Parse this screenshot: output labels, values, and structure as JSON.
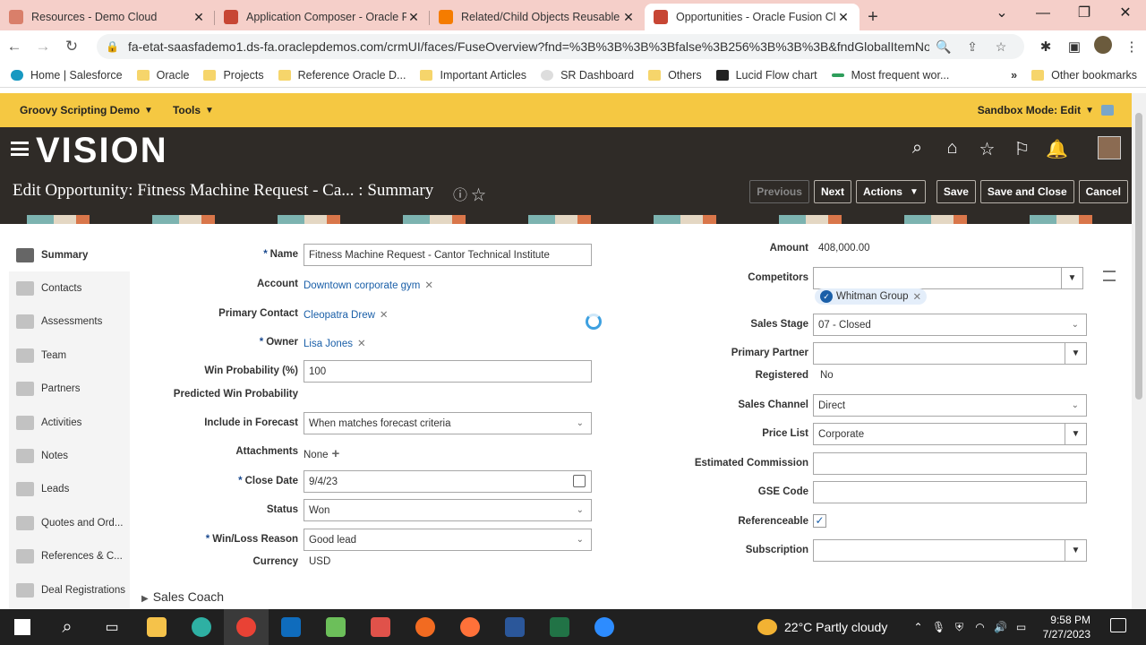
{
  "browser": {
    "tabs": [
      {
        "title": "Resources - Demo Cloud",
        "favicon": "cloud-icon",
        "color": "#d97f6a"
      },
      {
        "title": "Application Composer - Oracle F",
        "favicon": "oracle-icon",
        "color": "#c74634"
      },
      {
        "title": "Related/Child Objects Reusable C",
        "favicon": "blogger-icon",
        "color": "#f57c00"
      },
      {
        "title": "Opportunities - Oracle Fusion Clo",
        "favicon": "oracle-icon",
        "color": "#c74634"
      }
    ],
    "url": "fa-etat-saasfademo1.ds-fa.oraclepdemos.com/crmUI/faces/FuseOverview?fnd=%3B%3B%3B%3Bfalse%3B256%3B%3B%3B&fndGlobalItemNod...",
    "bookmarks": [
      "Home | Salesforce",
      "Oracle",
      "Projects",
      "Reference Oracle D...",
      "Important Articles",
      "SR Dashboard",
      "Others",
      "Lucid Flow chart",
      "Most frequent wor..."
    ],
    "bookmarks_overflow": "»",
    "other_bookmarks": "Other bookmarks"
  },
  "sandbox": {
    "menu1": "Groovy Scripting Demo",
    "menu2": "Tools",
    "mode": "Sandbox Mode: Edit"
  },
  "header": {
    "logo": "VISION",
    "title": "Edit Opportunity: Fitness Machine Request - Ca... : Summary",
    "buttons": {
      "previous": "Previous",
      "next": "Next",
      "actions": "Actions",
      "save": "Save",
      "save_close": "Save and Close",
      "cancel": "Cancel"
    }
  },
  "sidenav": [
    "Summary",
    "Contacts",
    "Assessments",
    "Team",
    "Partners",
    "Activities",
    "Notes",
    "Leads",
    "Quotes and Ord...",
    "References & C...",
    "Deal Registrations"
  ],
  "form": {
    "name_label": "Name",
    "name_value": "Fitness Machine Request - Cantor Technical Institute",
    "account_label": "Account",
    "account_value": "Downtown corporate gym",
    "primary_contact_label": "Primary Contact",
    "primary_contact_value": "Cleopatra Drew",
    "owner_label": "Owner",
    "owner_value": "Lisa Jones",
    "win_prob_label": "Win Probability (%)",
    "win_prob_value": "100",
    "predicted_label": "Predicted Win Probability",
    "forecast_label": "Include in Forecast",
    "forecast_value": "When matches forecast criteria",
    "attachments_label": "Attachments",
    "attachments_value": "None",
    "close_date_label": "Close Date",
    "close_date_value": "9/4/23",
    "status_label": "Status",
    "status_value": "Won",
    "winloss_label": "Win/Loss Reason",
    "winloss_value": "Good lead",
    "currency_label": "Currency",
    "currency_value": "USD",
    "sales_coach": "Sales Coach",
    "amount_label": "Amount",
    "amount_value": "408,000.00",
    "competitors_label": "Competitors",
    "competitor_chip": "Whitman Group",
    "sales_stage_label": "Sales Stage",
    "sales_stage_value": "07 - Closed",
    "primary_partner_label": "Primary Partner",
    "registered_label": "Registered",
    "registered_value": "No",
    "sales_channel_label": "Sales Channel",
    "sales_channel_value": "Direct",
    "price_list_label": "Price List",
    "price_list_value": "Corporate",
    "est_commission_label": "Estimated Commission",
    "gse_label": "GSE Code",
    "referenceable_label": "Referenceable",
    "subscription_label": "Subscription"
  },
  "taskbar": {
    "temperature": "22°C",
    "weather": "Partly cloudy",
    "time": "9:58 PM",
    "date": "7/27/2023"
  }
}
